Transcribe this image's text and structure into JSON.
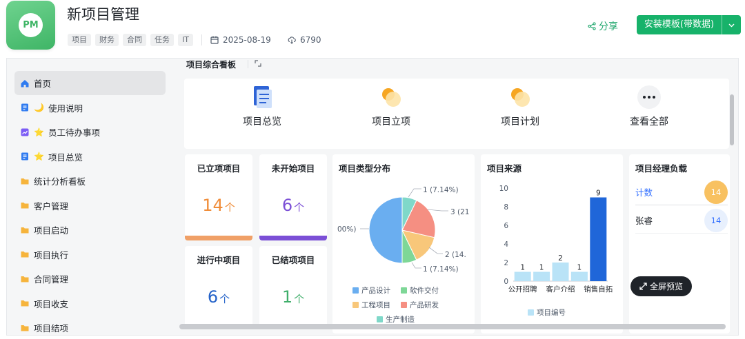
{
  "header": {
    "logo_text": "PM",
    "title": "新项目管理",
    "tags": [
      "项目",
      "财务",
      "合同",
      "任务",
      "IT"
    ],
    "date": "2025-08-19",
    "downloads": "6790",
    "share_label": "分享",
    "install_label": "安装模板(带数据)"
  },
  "sidebar": {
    "items": [
      {
        "label": "首页",
        "star": "",
        "icon": "home-icon",
        "active": true
      },
      {
        "label": "使用说明",
        "star": "🌙",
        "icon": "doc-icon"
      },
      {
        "label": "员工待办事项",
        "star": "⭐",
        "icon": "dashboard-icon"
      },
      {
        "label": "项目总览",
        "star": "⭐",
        "icon": "doc-icon"
      },
      {
        "label": "统计分析看板",
        "star": "",
        "icon": "folder-icon"
      },
      {
        "label": "客户管理",
        "star": "",
        "icon": "folder-icon"
      },
      {
        "label": "项目启动",
        "star": "",
        "icon": "folder-icon"
      },
      {
        "label": "项目执行",
        "star": "",
        "icon": "folder-icon"
      },
      {
        "label": "合同管理",
        "star": "",
        "icon": "folder-icon"
      },
      {
        "label": "项目收支",
        "star": "",
        "icon": "folder-icon"
      },
      {
        "label": "项目结项",
        "star": "",
        "icon": "folder-icon"
      }
    ]
  },
  "main": {
    "title": "项目综合看板",
    "shortcuts": [
      {
        "label": "项目总览",
        "icon": "overview-icon"
      },
      {
        "label": "项目立项",
        "icon": "sun-icon"
      },
      {
        "label": "项目计划",
        "icon": "sun-icon"
      },
      {
        "label": "查看全部",
        "icon": "more-icon"
      }
    ],
    "stats": [
      {
        "title": "已立项项目",
        "value": "14",
        "unit": "个",
        "color": "#f08c38",
        "bar": "#f0a067"
      },
      {
        "title": "未开始项目",
        "value": "6",
        "unit": "个",
        "color": "#7b4fd6",
        "bar": "#7b4fd6"
      },
      {
        "title": "进行中项目",
        "value": "6",
        "unit": "个",
        "color": "#2563c9"
      },
      {
        "title": "已结项项目",
        "value": "1",
        "unit": "个",
        "color": "#3fae6a"
      }
    ],
    "fullscreen_label": "全屏预览"
  },
  "pie_panel": {
    "title": "项目类型分布",
    "slice_labels": [
      "1 (7.14%)",
      "3 (21",
      "2 (14.",
      "1 (7.14%)",
      "00%)"
    ]
  },
  "bar_panel": {
    "title": "项目来源"
  },
  "pm_panel": {
    "title": "项目经理负载",
    "rows": [
      {
        "name": "计数",
        "value": "14",
        "name_color": "#3370ff",
        "badge_bg": "#f8c161",
        "badge_color": "#ffffff"
      },
      {
        "name": "张睿",
        "value": "14",
        "name_color": "#1f2329",
        "badge_bg": "#e8f0fd",
        "badge_color": "#3370ff"
      }
    ]
  },
  "chart_data": [
    {
      "type": "pie",
      "title": "项目类型分布",
      "categories": [
        "产品设计",
        "软件交付",
        "工程项目",
        "产品研发",
        "生产制造"
      ],
      "values": [
        7,
        1,
        2,
        3,
        1
      ],
      "colors": [
        "#6aaef0",
        "#7ed797",
        "#f8c77a",
        "#f58f82",
        "#7fd8c9"
      ],
      "legend": "bottom"
    },
    {
      "type": "bar",
      "title": "项目来源",
      "categories": [
        "公开招聘",
        "",
        "客户介绍",
        "",
        "销售自拓"
      ],
      "series": [
        {
          "name": "项目编号",
          "values": [
            1,
            1,
            2,
            1,
            9
          ]
        }
      ],
      "value_labels": [
        "1",
        "1",
        "2",
        "1",
        "9"
      ],
      "yticks": [
        "0",
        "2",
        "4",
        "6",
        "8",
        "10"
      ],
      "ylim": [
        0,
        10
      ],
      "colors": [
        "#b9e3f7",
        "#b9e3f7",
        "#b9e3f7",
        "#b9e3f7",
        "#1f66d9"
      ],
      "legend": "bottom"
    }
  ]
}
